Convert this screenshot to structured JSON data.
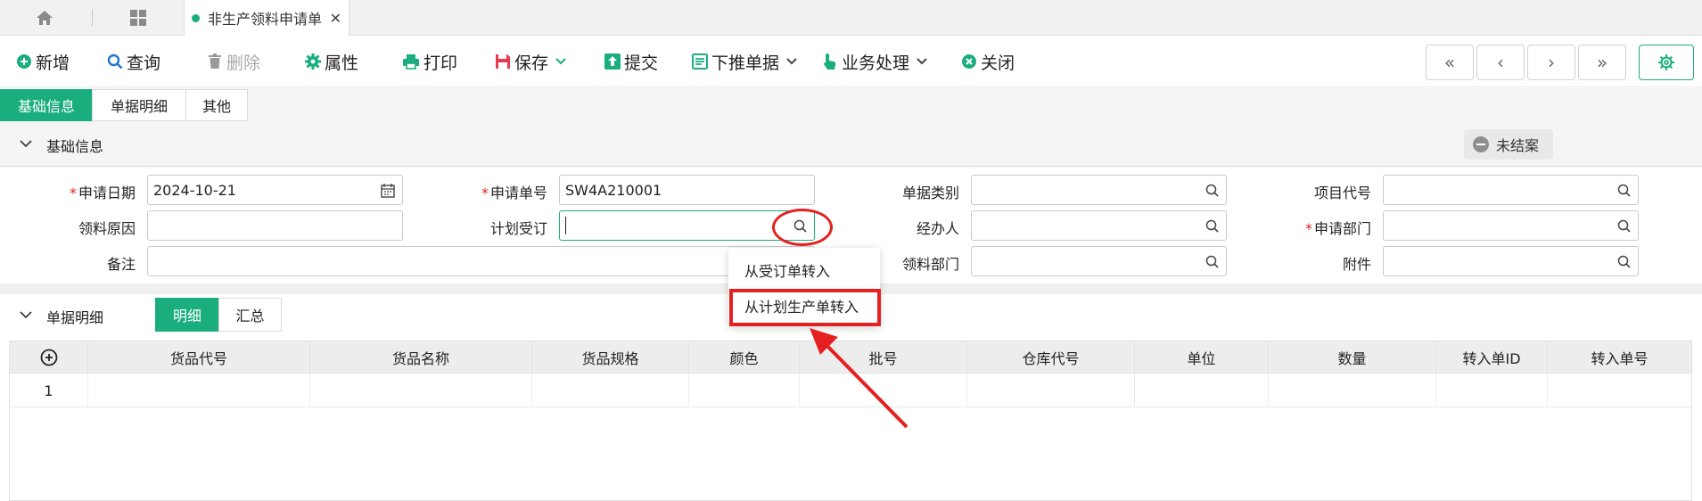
{
  "tabbar": {
    "doc_tab": {
      "label": "非生产领料申请单",
      "close": "✕"
    }
  },
  "toolbar": {
    "new": "新增",
    "query": "查询",
    "delete": "删除",
    "props": "属性",
    "print": "打印",
    "save": "保存",
    "submit": "提交",
    "push": "下推单据",
    "biz": "业务处理",
    "close": "关闭"
  },
  "nav": {
    "first": "«",
    "prev": "‹",
    "next": "›",
    "last": "»"
  },
  "subtabs": [
    "基础信息",
    "单据明细",
    "其他"
  ],
  "basic": {
    "title": "基础信息",
    "status": "未结案",
    "fields": {
      "apply_date": {
        "label": "申请日期",
        "value": "2024-10-21"
      },
      "apply_no": {
        "label": "申请单号",
        "value": "SW4A210001"
      },
      "doc_type": {
        "label": "单据类别",
        "value": ""
      },
      "project_code": {
        "label": "项目代号",
        "value": ""
      },
      "reason": {
        "label": "领料原因",
        "value": ""
      },
      "plan_order": {
        "label": "计划受订",
        "value": ""
      },
      "handler": {
        "label": "经办人",
        "value": ""
      },
      "apply_dept": {
        "label": "申请部门",
        "value": ""
      },
      "remark": {
        "label": "备注",
        "value": ""
      },
      "pick_dept": {
        "label": "领料部门",
        "value": ""
      },
      "attach": {
        "label": "附件",
        "value": ""
      }
    }
  },
  "detail": {
    "title": "单据明细",
    "segments": [
      "明细",
      "汇总"
    ],
    "columns": [
      "货品代号",
      "货品名称",
      "货品规格",
      "颜色",
      "批号",
      "仓库代号",
      "单位",
      "数量",
      "转入单ID",
      "转入单号"
    ],
    "rows": [
      {
        "index": "1"
      }
    ]
  },
  "dropdown": {
    "items": [
      "从受订单转入",
      "从计划生产单转入"
    ]
  },
  "colors": {
    "accent": "#1aad7e",
    "annotation": "#e52020",
    "required": "#e02424"
  }
}
